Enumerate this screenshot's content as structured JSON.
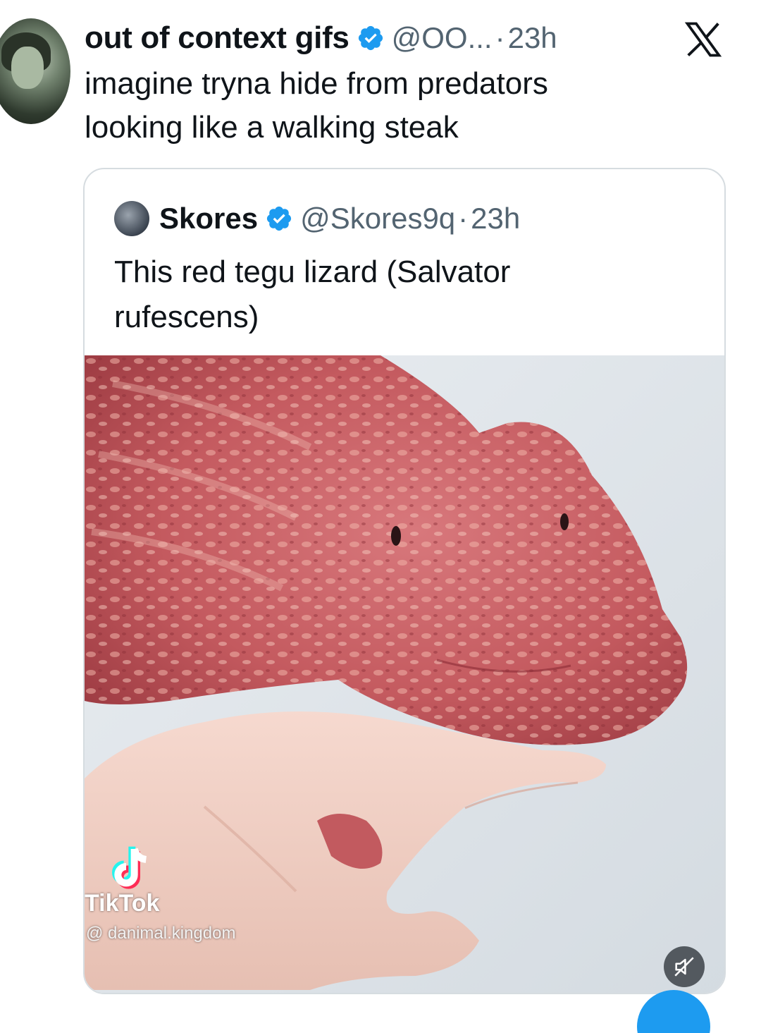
{
  "tweet": {
    "display_name": "out of context gifs",
    "handle": "@OO...",
    "separator": "·",
    "time": "23h",
    "text_line1": "imagine tryna hide from predators",
    "text_line2": "looking like a walking steak"
  },
  "quote": {
    "display_name": "Skores",
    "handle": "@Skores9q",
    "separator": "·",
    "time": "23h",
    "text_line1": "This red tegu lizard (Salvator",
    "text_line2": "rufescens)"
  },
  "media": {
    "watermark_name": "TikTok",
    "watermark_user": "@ danimal.kingdom"
  },
  "icons": {
    "verified": "verified-badge-icon",
    "platform": "x-logo-icon",
    "watermark": "tiktok-logo-icon",
    "mute": "speaker-muted-icon"
  },
  "colors": {
    "verified": "#1d9bf0",
    "secondary_text": "#536471",
    "border": "#d6dce0",
    "lizard": "#c65a5e",
    "accent": "#1d9bf0"
  }
}
